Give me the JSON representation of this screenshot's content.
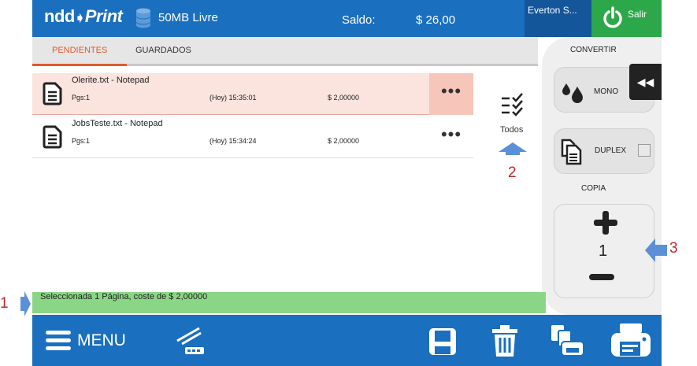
{
  "header": {
    "logo_part1": "ndd",
    "logo_part2": "Print",
    "storage_text": "50MB Livre",
    "saldo_label": "Saldo:",
    "saldo_value": "$ 26,00",
    "user_name": "Everton S...",
    "logout_label": "Salir"
  },
  "tabs": [
    {
      "label": "PENDIENTES",
      "active": true
    },
    {
      "label": "GUARDADOS",
      "active": false
    }
  ],
  "jobs": [
    {
      "name": "Olerite.txt - Notepad",
      "pages": "Pgs:1",
      "time": "(Hoy) 15:35:01",
      "price": "$ 2,00000",
      "selected": true
    },
    {
      "name": "JobsTeste.txt - Notepad",
      "pages": "Pgs:1",
      "time": "(Hoy) 15:34:24",
      "price": "$ 2,00000",
      "selected": false
    }
  ],
  "job_more_label": "•••",
  "select_all_label": "Todos",
  "panel": {
    "convertir_label": "CONVERTIR",
    "mono_label": "MONO",
    "duplex_label": "DUPLEX",
    "duplex_checked": false,
    "copia_label": "COPIA",
    "copy_count": "1",
    "collapse_symbol": "◀◀"
  },
  "status_text": "Seleccionada 1 Página, coste de $ 2,00000",
  "bottom": {
    "menu_label": "MENU"
  },
  "annotations": [
    "1",
    "2",
    "3"
  ],
  "colors": {
    "brand_blue": "#1a6fbe",
    "logout_green": "#2ca84a",
    "selected_row": "#fbe3de",
    "status_green": "#8bd686",
    "active_tab": "#e05a2a",
    "annotation_red": "#c0282d",
    "annotation_arrow": "#5b8fd6"
  },
  "icons": [
    "database-icon",
    "power-icon",
    "document-icon",
    "checklist-icon",
    "arrow-up-icon",
    "ink-drops-icon",
    "duplex-icon",
    "hamburger-icon",
    "scanner-icon",
    "save-icon",
    "trash-icon",
    "copy-print-icon",
    "printer-icon"
  ]
}
